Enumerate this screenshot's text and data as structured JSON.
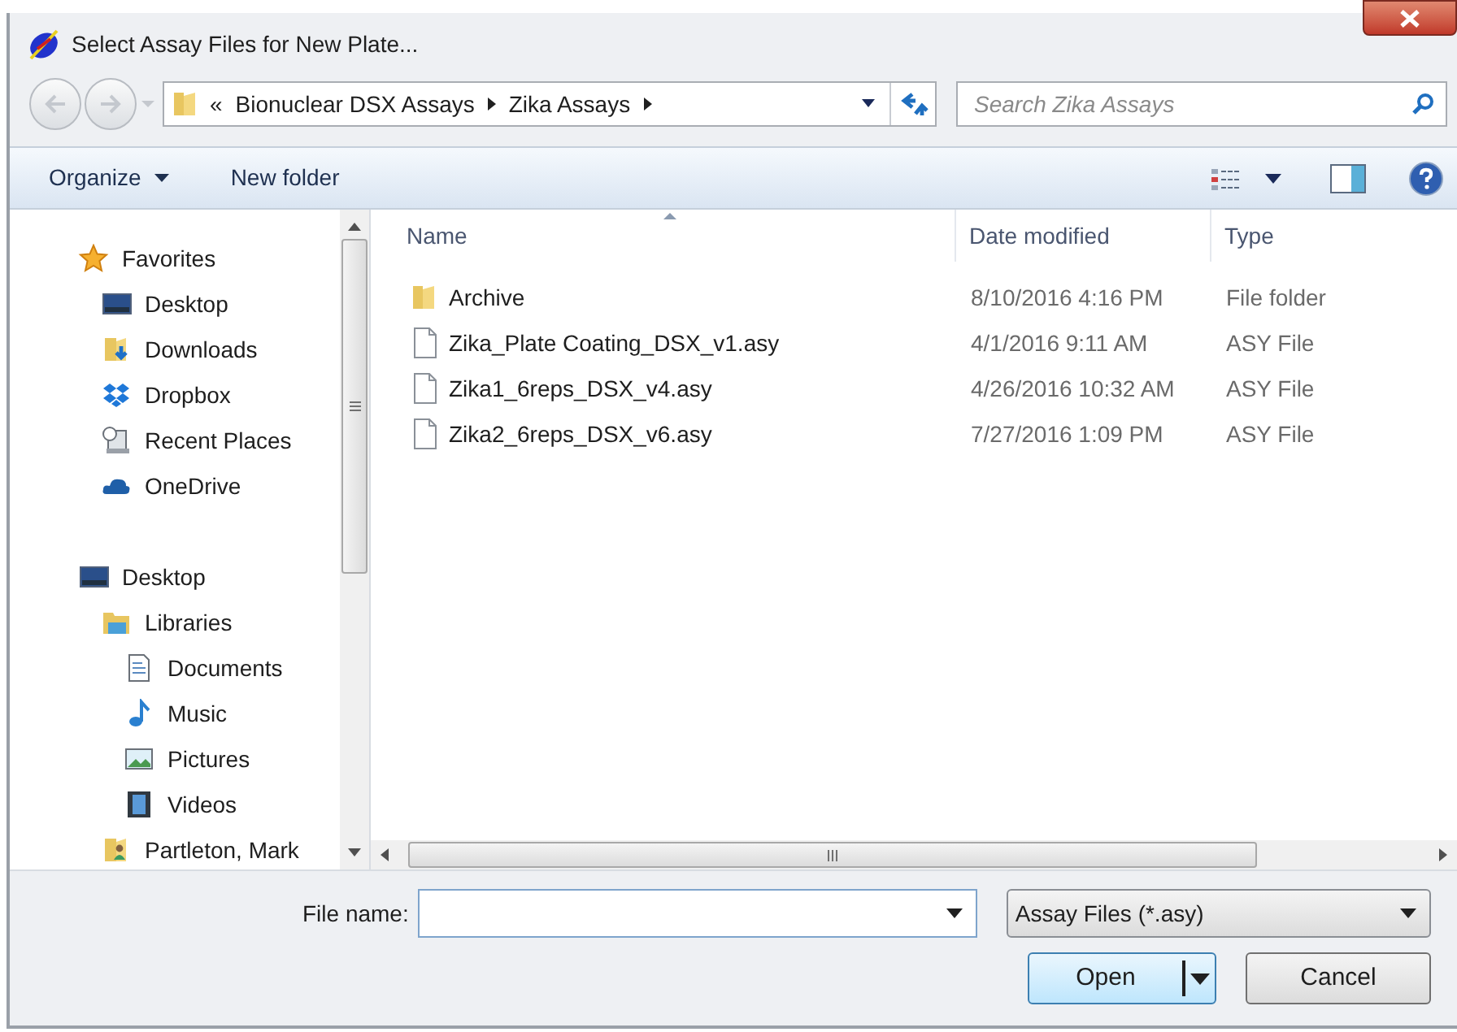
{
  "window": {
    "title": "Select Assay Files for New Plate..."
  },
  "address": {
    "breadcrumbs": [
      "«",
      "Bionuclear DSX Assays",
      "Zika Assays"
    ]
  },
  "search": {
    "placeholder": "Search Zika Assays"
  },
  "toolbar": {
    "buttons": [
      "Organize",
      "New folder"
    ]
  },
  "navigation": [
    {
      "label": "Favorites",
      "kind": "star",
      "children": [
        {
          "label": "Desktop",
          "kind": "desktop"
        },
        {
          "label": "Downloads",
          "kind": "downloads"
        },
        {
          "label": "Dropbox",
          "kind": "dropbox"
        },
        {
          "label": "Recent Places",
          "kind": "recent"
        },
        {
          "label": "OneDrive",
          "kind": "cloud"
        }
      ]
    },
    {
      "label": "Desktop",
      "kind": "desktop",
      "children": [
        {
          "label": "Libraries",
          "kind": "libraries",
          "children": [
            {
              "label": "Documents",
              "kind": "documents"
            },
            {
              "label": "Music",
              "kind": "music"
            },
            {
              "label": "Pictures",
              "kind": "pictures"
            },
            {
              "label": "Videos",
              "kind": "videos"
            }
          ]
        },
        {
          "label": "Partleton, Mark",
          "kind": "user"
        }
      ]
    }
  ],
  "table": {
    "columns": [
      {
        "label": "Name",
        "sorted": true
      },
      {
        "label": "Date modified",
        "sorted": false
      },
      {
        "label": "Type",
        "sorted": false
      }
    ],
    "rows": [
      {
        "kind": "folder",
        "name": "Archive",
        "date": "8/10/2016 4:16 PM",
        "type": "File folder"
      },
      {
        "kind": "file",
        "name": "Zika_Plate Coating_DSX_v1.asy",
        "date": "4/1/2016 9:11 AM",
        "type": "ASY File"
      },
      {
        "kind": "file",
        "name": "Zika1_6reps_DSX_v4.asy",
        "date": "4/26/2016 10:32 AM",
        "type": "ASY File"
      },
      {
        "kind": "file",
        "name": "Zika2_6reps_DSX_v6.asy",
        "date": "7/27/2016 1:09 PM",
        "type": "ASY File"
      }
    ]
  },
  "file_name": {
    "label": "File name:"
  },
  "file_type": {
    "value": "Assay Files (*.asy)"
  },
  "buttons": [
    {
      "label": "Open",
      "kind": "split"
    },
    {
      "label": "Cancel",
      "kind": "plain"
    }
  ]
}
